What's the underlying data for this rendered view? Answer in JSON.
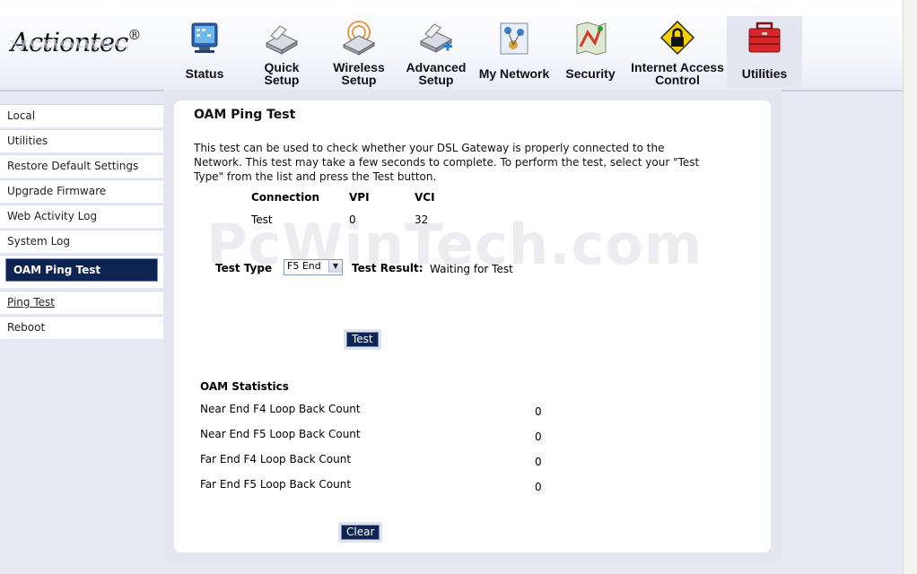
{
  "logo": {
    "text": "Actiontec",
    "reg": "®"
  },
  "nav": [
    {
      "id": "status",
      "label": "Status",
      "icon": "status-monitor-icon"
    },
    {
      "id": "quick-setup",
      "label": "Quick\nSetup",
      "icon": "router-quick-setup-icon"
    },
    {
      "id": "wireless-setup",
      "label": "Wireless\nSetup",
      "icon": "router-wireless-icon"
    },
    {
      "id": "advanced-setup",
      "label": "Advanced\nSetup",
      "icon": "router-advanced-icon"
    },
    {
      "id": "my-network",
      "label": "My Network",
      "icon": "network-map-icon"
    },
    {
      "id": "security",
      "label": "Security",
      "icon": "security-map-icon"
    },
    {
      "id": "internet-access-control",
      "label": "Internet Access\nControl",
      "icon": "lock-warning-icon"
    },
    {
      "id": "utilities",
      "label": "Utilities",
      "icon": "toolbox-icon",
      "active": true
    }
  ],
  "sidebar": [
    {
      "label": "Local"
    },
    {
      "label": "Utilities"
    },
    {
      "label": "Restore Default Settings"
    },
    {
      "label": "Upgrade Firmware"
    },
    {
      "label": "Web Activity Log"
    },
    {
      "label": "System Log"
    },
    {
      "label": "OAM Ping Test",
      "active": true
    },
    {
      "label": "Ping Test",
      "sub": true
    },
    {
      "label": "Reboot"
    }
  ],
  "main": {
    "title": "OAM Ping Test",
    "intro": "This test can be used to check whether your DSL Gateway is properly connected to the Network. This test may take a few seconds to complete. To perform the test, select your \"Test Type\" from the list and press the Test button.",
    "connection_table": {
      "headers": [
        "Connection",
        "VPI",
        "VCI"
      ],
      "row": [
        "Test",
        "0",
        "32"
      ]
    },
    "test_type_label": "Test Type",
    "test_type_value": "F5 End",
    "test_result_label": "Test Result:",
    "test_result_value": "Waiting for Test",
    "test_button": "Test",
    "stats_title": "OAM Statistics",
    "stats": [
      {
        "label": "Near End F4 Loop Back Count",
        "value": "0"
      },
      {
        "label": "Near End F5 Loop Back Count",
        "value": "0"
      },
      {
        "label": "Far End F4 Loop Back Count",
        "value": "0"
      },
      {
        "label": "Far End F5 Loop Back Count",
        "value": "0"
      }
    ],
    "clear_button": "Clear"
  },
  "watermark": "PcWinTech.com"
}
